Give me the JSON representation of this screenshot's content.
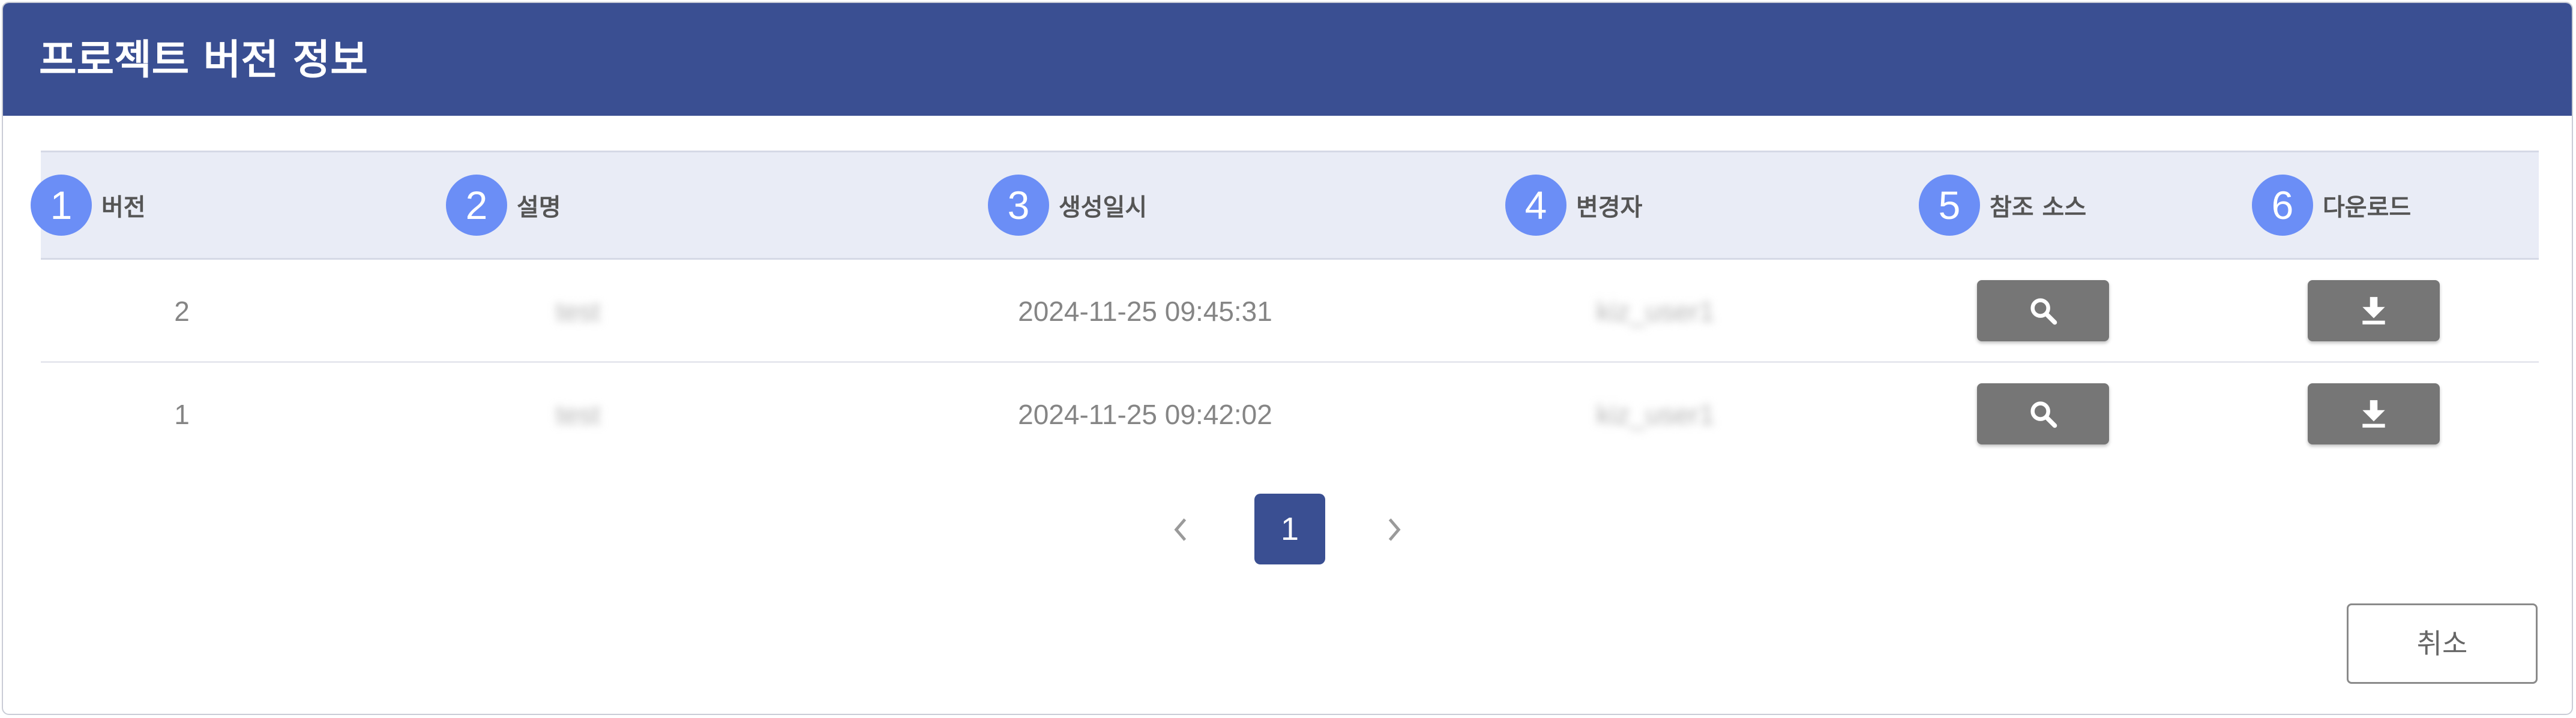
{
  "dialog": {
    "title": "프로젝트 버전 정보",
    "header_color": "#3a4f92",
    "badge_color": "#6b8ef6"
  },
  "table": {
    "columns": [
      {
        "badge": "1",
        "label": "버전"
      },
      {
        "badge": "2",
        "label": "설명"
      },
      {
        "badge": "3",
        "label": "생성일시"
      },
      {
        "badge": "4",
        "label": "변경자"
      },
      {
        "badge": "5",
        "label": "참조 소스"
      },
      {
        "badge": "6",
        "label": "다운로드"
      }
    ],
    "rows": [
      {
        "version": "2",
        "description": "test",
        "created_at": "2024-11-25 09:45:31",
        "changed_by": "kiz_user1"
      },
      {
        "version": "1",
        "description": "test",
        "created_at": "2024-11-25 09:42:02",
        "changed_by": "kiz_user1"
      }
    ],
    "source_icon": "search-icon",
    "download_icon": "download-icon"
  },
  "pagination": {
    "current_page": "1",
    "prev_icon": "chevron-left-icon",
    "next_icon": "chevron-right-icon"
  },
  "footer": {
    "cancel_label": "취소"
  }
}
